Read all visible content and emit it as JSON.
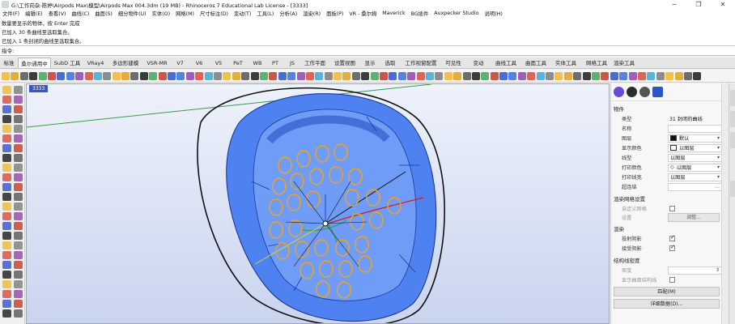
{
  "window": {
    "title": "G:\\工作向杂-陈婷\\Airpods Max\\模型\\Airpods Max 004.3dm (19 MB) - Rhinoceros 7 Educational Lab License - [3333]",
    "controls": [
      "─",
      "❐",
      "✕"
    ]
  },
  "menubar": [
    "文件(F)",
    "编辑(E)",
    "查看(V)",
    "曲线(C)",
    "曲面(S)",
    "细分物件(U)",
    "实体(O)",
    "网格(M)",
    "尺寸标注(D)",
    "变动(T)",
    "工具(L)",
    "分析(A)",
    "渲染(R)",
    "面板(P)",
    "VR - 桑尔姆",
    "Maverick",
    "BG插件",
    "Auxpecker Studio",
    "说明(H)"
  ],
  "command_history": {
    "lines": [
      "数量要显示的物体，按 Enter 完成",
      "已加入 30 条曲线至选取集合。",
      "已加入 1 条封闭的曲线至选取集合。"
    ],
    "prompt": "指令:"
  },
  "tabs": {
    "active": "桑尔通用中",
    "items": [
      "标准",
      "桑尔通用中",
      "SubD 工具",
      "VRay4",
      "多边形建模",
      "VSR-MR",
      "V7",
      "V6",
      "V5",
      "PeT",
      "WB",
      "PT",
      "JS",
      "工作平面",
      "设置视图",
      "显示",
      "选取",
      "工作视窗配置",
      "可见性",
      "变动",
      "曲线工具",
      "曲面工具",
      "实体工具",
      "网格工具",
      "渲染工具"
    ]
  },
  "viewport": {
    "label": "3333"
  },
  "properties": {
    "section_object": "物件",
    "rows": [
      {
        "label": "类型",
        "value": "31 封闭的曲线"
      },
      {
        "label": "名称",
        "value": ""
      },
      {
        "label": "图层",
        "value": "默认"
      },
      {
        "label": "显示颜色",
        "value": "以图层"
      },
      {
        "label": "线型",
        "value": "以图层"
      },
      {
        "label": "打印颜色",
        "value": "以图层"
      },
      {
        "label": "打印线宽",
        "value": "以图层"
      },
      {
        "label": "超连结",
        "value": ""
      }
    ],
    "section_render_mesh": "渲染网格设置",
    "custom_mesh_label": "自定义网格",
    "settings_label": "设置",
    "settings_button": "调整...",
    "section_render": "渲染",
    "cast_shadows_label": "投射阴影",
    "receive_shadows_label": "接受阴影",
    "section_isocurve": "结构线密度",
    "density_label": "密度",
    "show_surface_isocurves_label": "显示曲面结构线",
    "match_button": "匹配(M)",
    "details_button": "详细数据(D)..."
  },
  "colors": {
    "accent_tab": "#ffffff",
    "viewport_label_bg": "#3b55c8",
    "surface_blue": "#4d82f0",
    "curve_orange": "#f4a21a"
  }
}
